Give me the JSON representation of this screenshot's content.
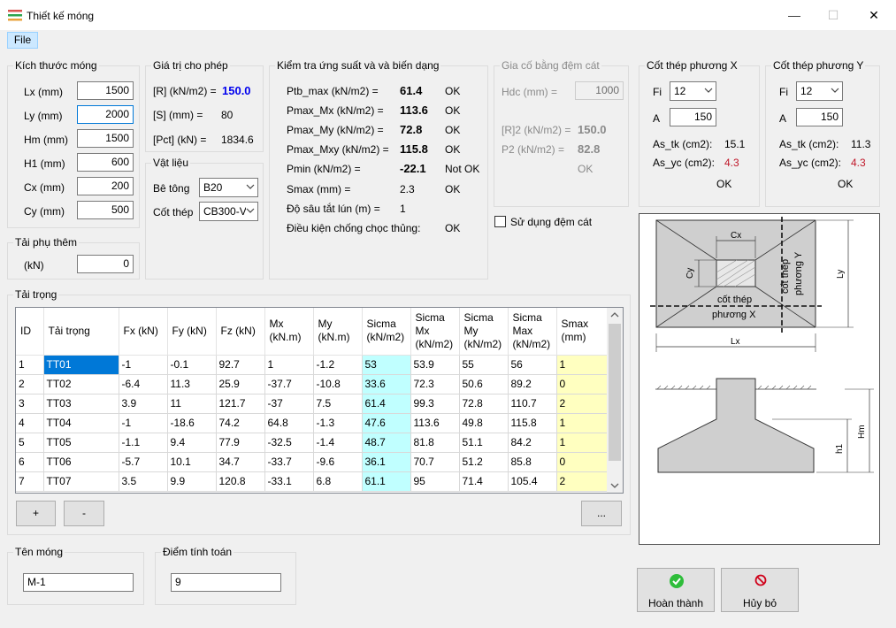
{
  "window": {
    "title": "Thiết kế móng",
    "minimize": "—",
    "maximize": "☐",
    "close": "✕"
  },
  "menu": {
    "file": "File"
  },
  "kich_thuoc": {
    "title": "Kích thước móng",
    "fields": [
      {
        "label": "Lx (mm)",
        "value": "1500"
      },
      {
        "label": "Ly (mm)",
        "value": "2000"
      },
      {
        "label": "Hm (mm)",
        "value": "1500"
      },
      {
        "label": "H1 (mm)",
        "value": "600"
      },
      {
        "label": "Cx (mm)",
        "value": "200"
      },
      {
        "label": "Cy (mm)",
        "value": "500"
      }
    ]
  },
  "tai_phu": {
    "title": "Tải phụ thêm",
    "label": "(kN)",
    "value": "0"
  },
  "gia_tri": {
    "title": "Giá trị cho phép",
    "r_label": "[R] (kN/m2) =",
    "r_value": "150.0",
    "s_label": "[S] (mm) =",
    "s_value": "80",
    "pct_label": "[Pct] (kN) =",
    "pct_value": "1834.6"
  },
  "vat_lieu": {
    "title": "Vật liệu",
    "be_tong_label": "Bê tông",
    "be_tong": "B20",
    "cot_thep_label": "Cốt thép",
    "cot_thep": "CB300-V"
  },
  "kiem_tra": {
    "title": "Kiểm tra ứng suất và và biến dạng",
    "rows": [
      {
        "label": "Ptb_max (kN/m2) =",
        "value": "61.4",
        "status": "OK"
      },
      {
        "label": "Pmax_Mx (kN/m2) =",
        "value": "113.6",
        "status": "OK"
      },
      {
        "label": "Pmax_My (kN/m2) =",
        "value": "72.8",
        "status": "OK"
      },
      {
        "label": "Pmax_Mxy (kN/m2) =",
        "value": "115.8",
        "status": "OK"
      },
      {
        "label": "Pmin (kN/m2) =",
        "value": "-22.1",
        "status": "Not OK"
      },
      {
        "label": "Smax (mm) =",
        "value": "2.3",
        "status": "OK"
      },
      {
        "label": "Độ sâu tắt lún (m) =",
        "value": "1",
        "status": ""
      },
      {
        "label": "Điều kiện chống chọc thủng:",
        "value": "",
        "status": "OK"
      }
    ]
  },
  "gia_co": {
    "title": "Gia cố bằng đệm cát",
    "hdc_label": "Hdc (mm) =",
    "hdc_value": "1000",
    "r2_label": "[R]2 (kN/m2) =",
    "r2_value": "150.0",
    "p2_label": "P2 (kN/m2) =",
    "p2_value": "82.8",
    "status": "OK",
    "checkbox_label": "Sử dụng đệm cát"
  },
  "cot_thep_x": {
    "title": "Cốt thép phương X",
    "fi_label": "Fi",
    "fi": "12",
    "a_label": "A",
    "a": "150",
    "as_tk_label": "As_tk (cm2):",
    "as_tk": "15.1",
    "as_yc_label": "As_yc (cm2):",
    "as_yc": "4.3",
    "status": "OK"
  },
  "cot_thep_y": {
    "title": "Cốt thép phương Y",
    "fi_label": "Fi",
    "fi": "12",
    "a_label": "A",
    "a": "150",
    "as_tk_label": "As_tk (cm2):",
    "as_tk": "11.3",
    "as_yc_label": "As_yc (cm2):",
    "as_yc": "4.3",
    "status": "OK"
  },
  "diagram": {
    "cx": "Cx",
    "cy": "Cy",
    "ly": "Ly",
    "lx": "Lx",
    "hm": "Hm",
    "h1": "h1",
    "steel_y": "cốt thép",
    "steel_y2": "phương Y",
    "steel_x": "cốt thép",
    "steel_x2": "phương X"
  },
  "tai_trong": {
    "title": "Tải trọng",
    "columns": [
      "ID",
      "Tải trọng",
      "Fx (kN)",
      "Fy (kN)",
      "Fz (kN)",
      "Mx (kN.m)",
      "My (kN.m)",
      "Sicma (kN/m2)",
      "Sicma Mx (kN/m2)",
      "Sicma My (kN/m2)",
      "Sicma Max (kN/m2)",
      "Smax (mm)"
    ],
    "rows": [
      [
        "1",
        "TT01",
        "-1",
        "-0.1",
        "92.7",
        "1",
        "-1.2",
        "53",
        "53.9",
        "55",
        "56",
        "1"
      ],
      [
        "2",
        "TT02",
        "-6.4",
        "11.3",
        "25.9",
        "-37.7",
        "-10.8",
        "33.6",
        "72.3",
        "50.6",
        "89.2",
        "0"
      ],
      [
        "3",
        "TT03",
        "3.9",
        "11",
        "121.7",
        "-37",
        "7.5",
        "61.4",
        "99.3",
        "72.8",
        "110.7",
        "2"
      ],
      [
        "4",
        "TT04",
        "-1",
        "-18.6",
        "74.2",
        "64.8",
        "-1.3",
        "47.6",
        "113.6",
        "49.8",
        "115.8",
        "1"
      ],
      [
        "5",
        "TT05",
        "-1.1",
        "9.4",
        "77.9",
        "-32.5",
        "-1.4",
        "48.7",
        "81.8",
        "51.1",
        "84.2",
        "1"
      ],
      [
        "6",
        "TT06",
        "-5.7",
        "10.1",
        "34.7",
        "-33.7",
        "-9.6",
        "36.1",
        "70.7",
        "51.2",
        "85.8",
        "0"
      ],
      [
        "7",
        "TT07",
        "3.5",
        "9.9",
        "120.8",
        "-33.1",
        "6.8",
        "61.1",
        "95",
        "71.4",
        "105.4",
        "2"
      ]
    ],
    "add": "+",
    "remove": "-",
    "more": "..."
  },
  "ten_mong": {
    "title": "Tên móng",
    "value": "M-1"
  },
  "diem_tinh": {
    "title": "Điểm tính toán",
    "value": "9"
  },
  "buttons": {
    "ok": "Hoàn thành",
    "cancel": "Hủy bỏ"
  },
  "colors": {
    "accent": "#0078d7",
    "ok_green": "#2ebd3a",
    "cancel_red": "#d0021b",
    "cyan_cell": "#c0ffff",
    "yellow_cell": "#ffffc0"
  }
}
